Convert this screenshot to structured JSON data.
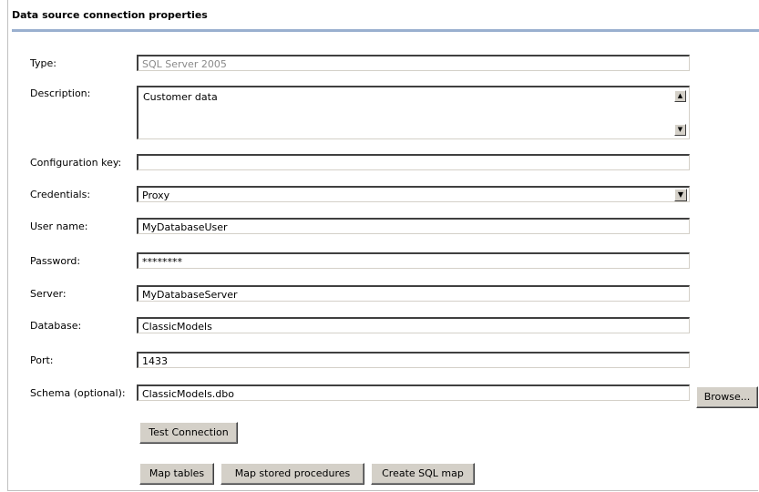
{
  "header": {
    "title": "Data source connection properties"
  },
  "form": {
    "type": {
      "label": "Type:",
      "value": "SQL Server 2005"
    },
    "description": {
      "label": "Description:",
      "value": "Customer data"
    },
    "config_key": {
      "label": "Configuration key:",
      "value": ""
    },
    "credentials": {
      "label": "Credentials:",
      "value": "Proxy"
    },
    "username": {
      "label": "User name:",
      "value": "MyDatabaseUser"
    },
    "password": {
      "label": "Password:",
      "value": "********"
    },
    "server": {
      "label": "Server:",
      "value": "MyDatabaseServer"
    },
    "database": {
      "label": "Database:",
      "value": "ClassicModels"
    },
    "port": {
      "label": "Port:",
      "value": "1433"
    },
    "schema": {
      "label": "Schema (optional):",
      "value": "ClassicModels.dbo"
    }
  },
  "buttons": {
    "browse": "Browse...",
    "test_connection": "Test Connection",
    "map_tables": "Map tables",
    "map_stored_procedures": "Map stored procedures",
    "create_sql_map": "Create SQL map"
  },
  "icons": {
    "scroll_up": "scroll-up-arrow",
    "scroll_down": "scroll-down-arrow",
    "dropdown": "chevron-down"
  }
}
